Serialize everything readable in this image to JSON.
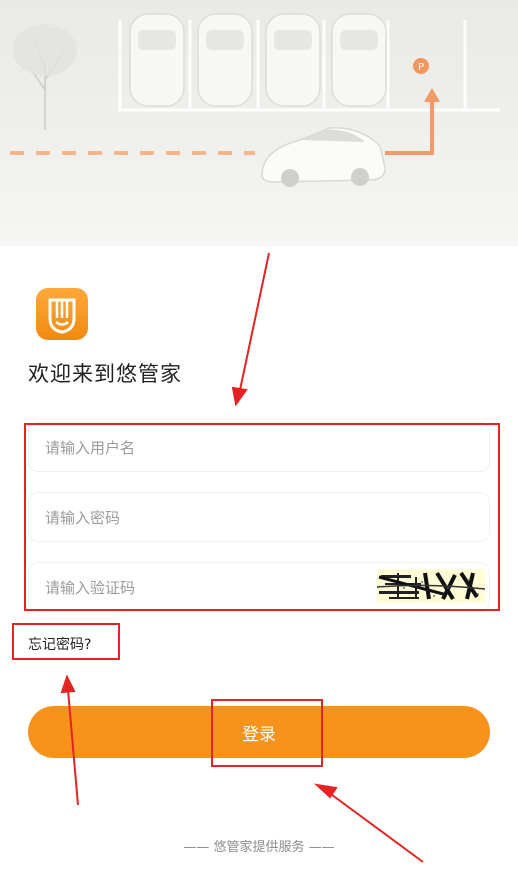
{
  "welcome_title": "欢迎来到悠管家",
  "form": {
    "username_placeholder": "请输入用户名",
    "password_placeholder": "请输入密码",
    "captcha_placeholder": "请输入验证码",
    "forgot_password": "忘记密码?",
    "login_button": "登录"
  },
  "footer_text": "—— 悠管家提供服务 ——",
  "hero": {
    "parking_marker": "P"
  },
  "colors": {
    "accent": "#f7931b",
    "annotation": "#e62323",
    "captcha_bg": "#fffcd6"
  },
  "icons": [
    "app-logo-icon",
    "parking-icon"
  ]
}
